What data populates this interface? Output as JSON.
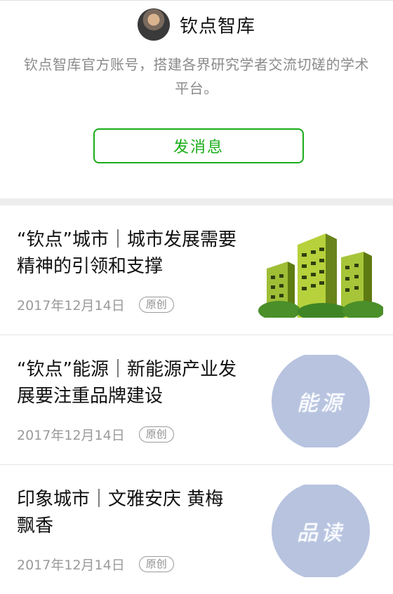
{
  "account": {
    "name": "钦点智库",
    "description": "钦点智库官方账号，搭建各界研究学者交流切磋的学术平台。",
    "message_button": "发消息"
  },
  "articles": [
    {
      "title": "“钦点”城市｜城市发展需要精神的引领和支撑",
      "date": "2017年12月14日",
      "badge": "原创",
      "thumb": "buildings-illustration"
    },
    {
      "title": "“钦点”能源｜新能源产业发展要注重品牌建设",
      "date": "2017年12月14日",
      "badge": "原创",
      "thumb_text": "能源"
    },
    {
      "title": "印象城市｜文雅安庆 黄梅飘香",
      "date": "2017年12月14日",
      "badge": "原创",
      "thumb_text": "品读"
    }
  ]
}
